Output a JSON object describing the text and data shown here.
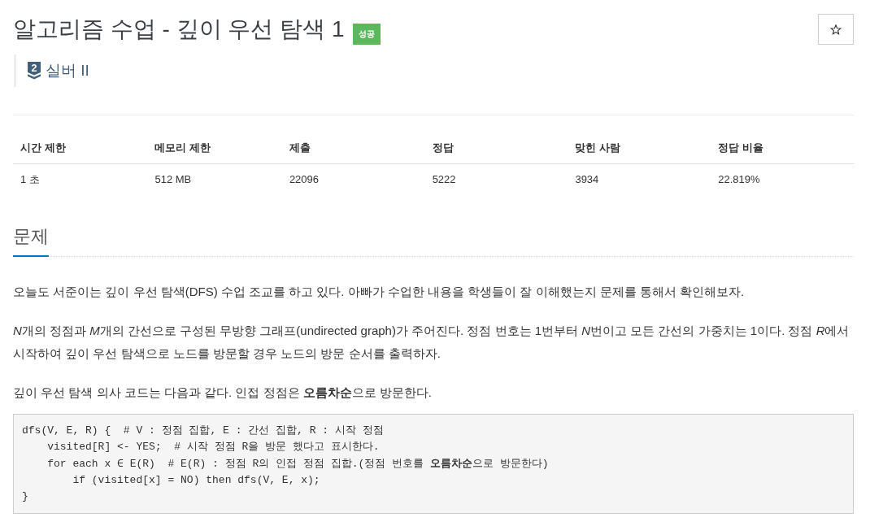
{
  "problem": {
    "title": "알고리즘 수업 - 깊이 우선 탐색 1",
    "result": {
      "label": "성공",
      "kind": "success"
    },
    "starred": false,
    "tier": {
      "kind": "silver",
      "number": "2",
      "label": "실버 II"
    }
  },
  "stats": {
    "columns": [
      "시간 제한",
      "메모리 제한",
      "제출",
      "정답",
      "맞힌 사람",
      "정답 비율"
    ],
    "rows": [
      [
        "1 초",
        "512 MB",
        "22096",
        "5222",
        "3934",
        "22.819%"
      ]
    ]
  },
  "description": {
    "heading": "문제",
    "paragraphs": [
      [
        {
          "kind": "text",
          "text": "오늘도 서준이는 깊이 우선 탐색(DFS) 수업 조교를 하고 있다. 아빠가 수업한 내용을 학생들이 잘 이해했는지 문제를 통해서 확인해보자."
        }
      ],
      [
        {
          "kind": "variable",
          "text": "N"
        },
        {
          "kind": "text",
          "text": "개의 정점과 "
        },
        {
          "kind": "variable",
          "text": "M"
        },
        {
          "kind": "text",
          "text": "개의 간선으로 구성된 무방향 그래프(undirected graph)가 주어진다. 정점 번호는 1번부터 "
        },
        {
          "kind": "variable",
          "text": "N"
        },
        {
          "kind": "text",
          "text": "번이고 모든 간선의 가중치는 1이다. 정점 "
        },
        {
          "kind": "variable",
          "text": "R"
        },
        {
          "kind": "text",
          "text": "에서 시작하여 깊이 우선 탐색으로 노드를 방문할 경우 노드의 방문 순서를 출력하자."
        }
      ],
      [
        {
          "kind": "text",
          "text": "깊이 우선 탐색 의사 코드는 다음과 같다. 인접 정점은 "
        },
        {
          "kind": "strong",
          "text": "오름차순"
        },
        {
          "kind": "text",
          "text": "으로 방문한다."
        }
      ]
    ],
    "code": [
      "dfs(V, E, R) {  # V : 정점 집합, E : 간선 집합, R : 시작 정점",
      "    visited[R] <- YES;  # 시작 정점 R을 방문 했다고 표시한다.",
      "    for each x ∈ E(R)  # E(R) : 정점 R의 인접 정점 집합.(정점 번호를 **오름차순**으로 방문한다)",
      "        if (visited[x] = NO) then dfs(V, E, x);",
      "}"
    ]
  }
}
